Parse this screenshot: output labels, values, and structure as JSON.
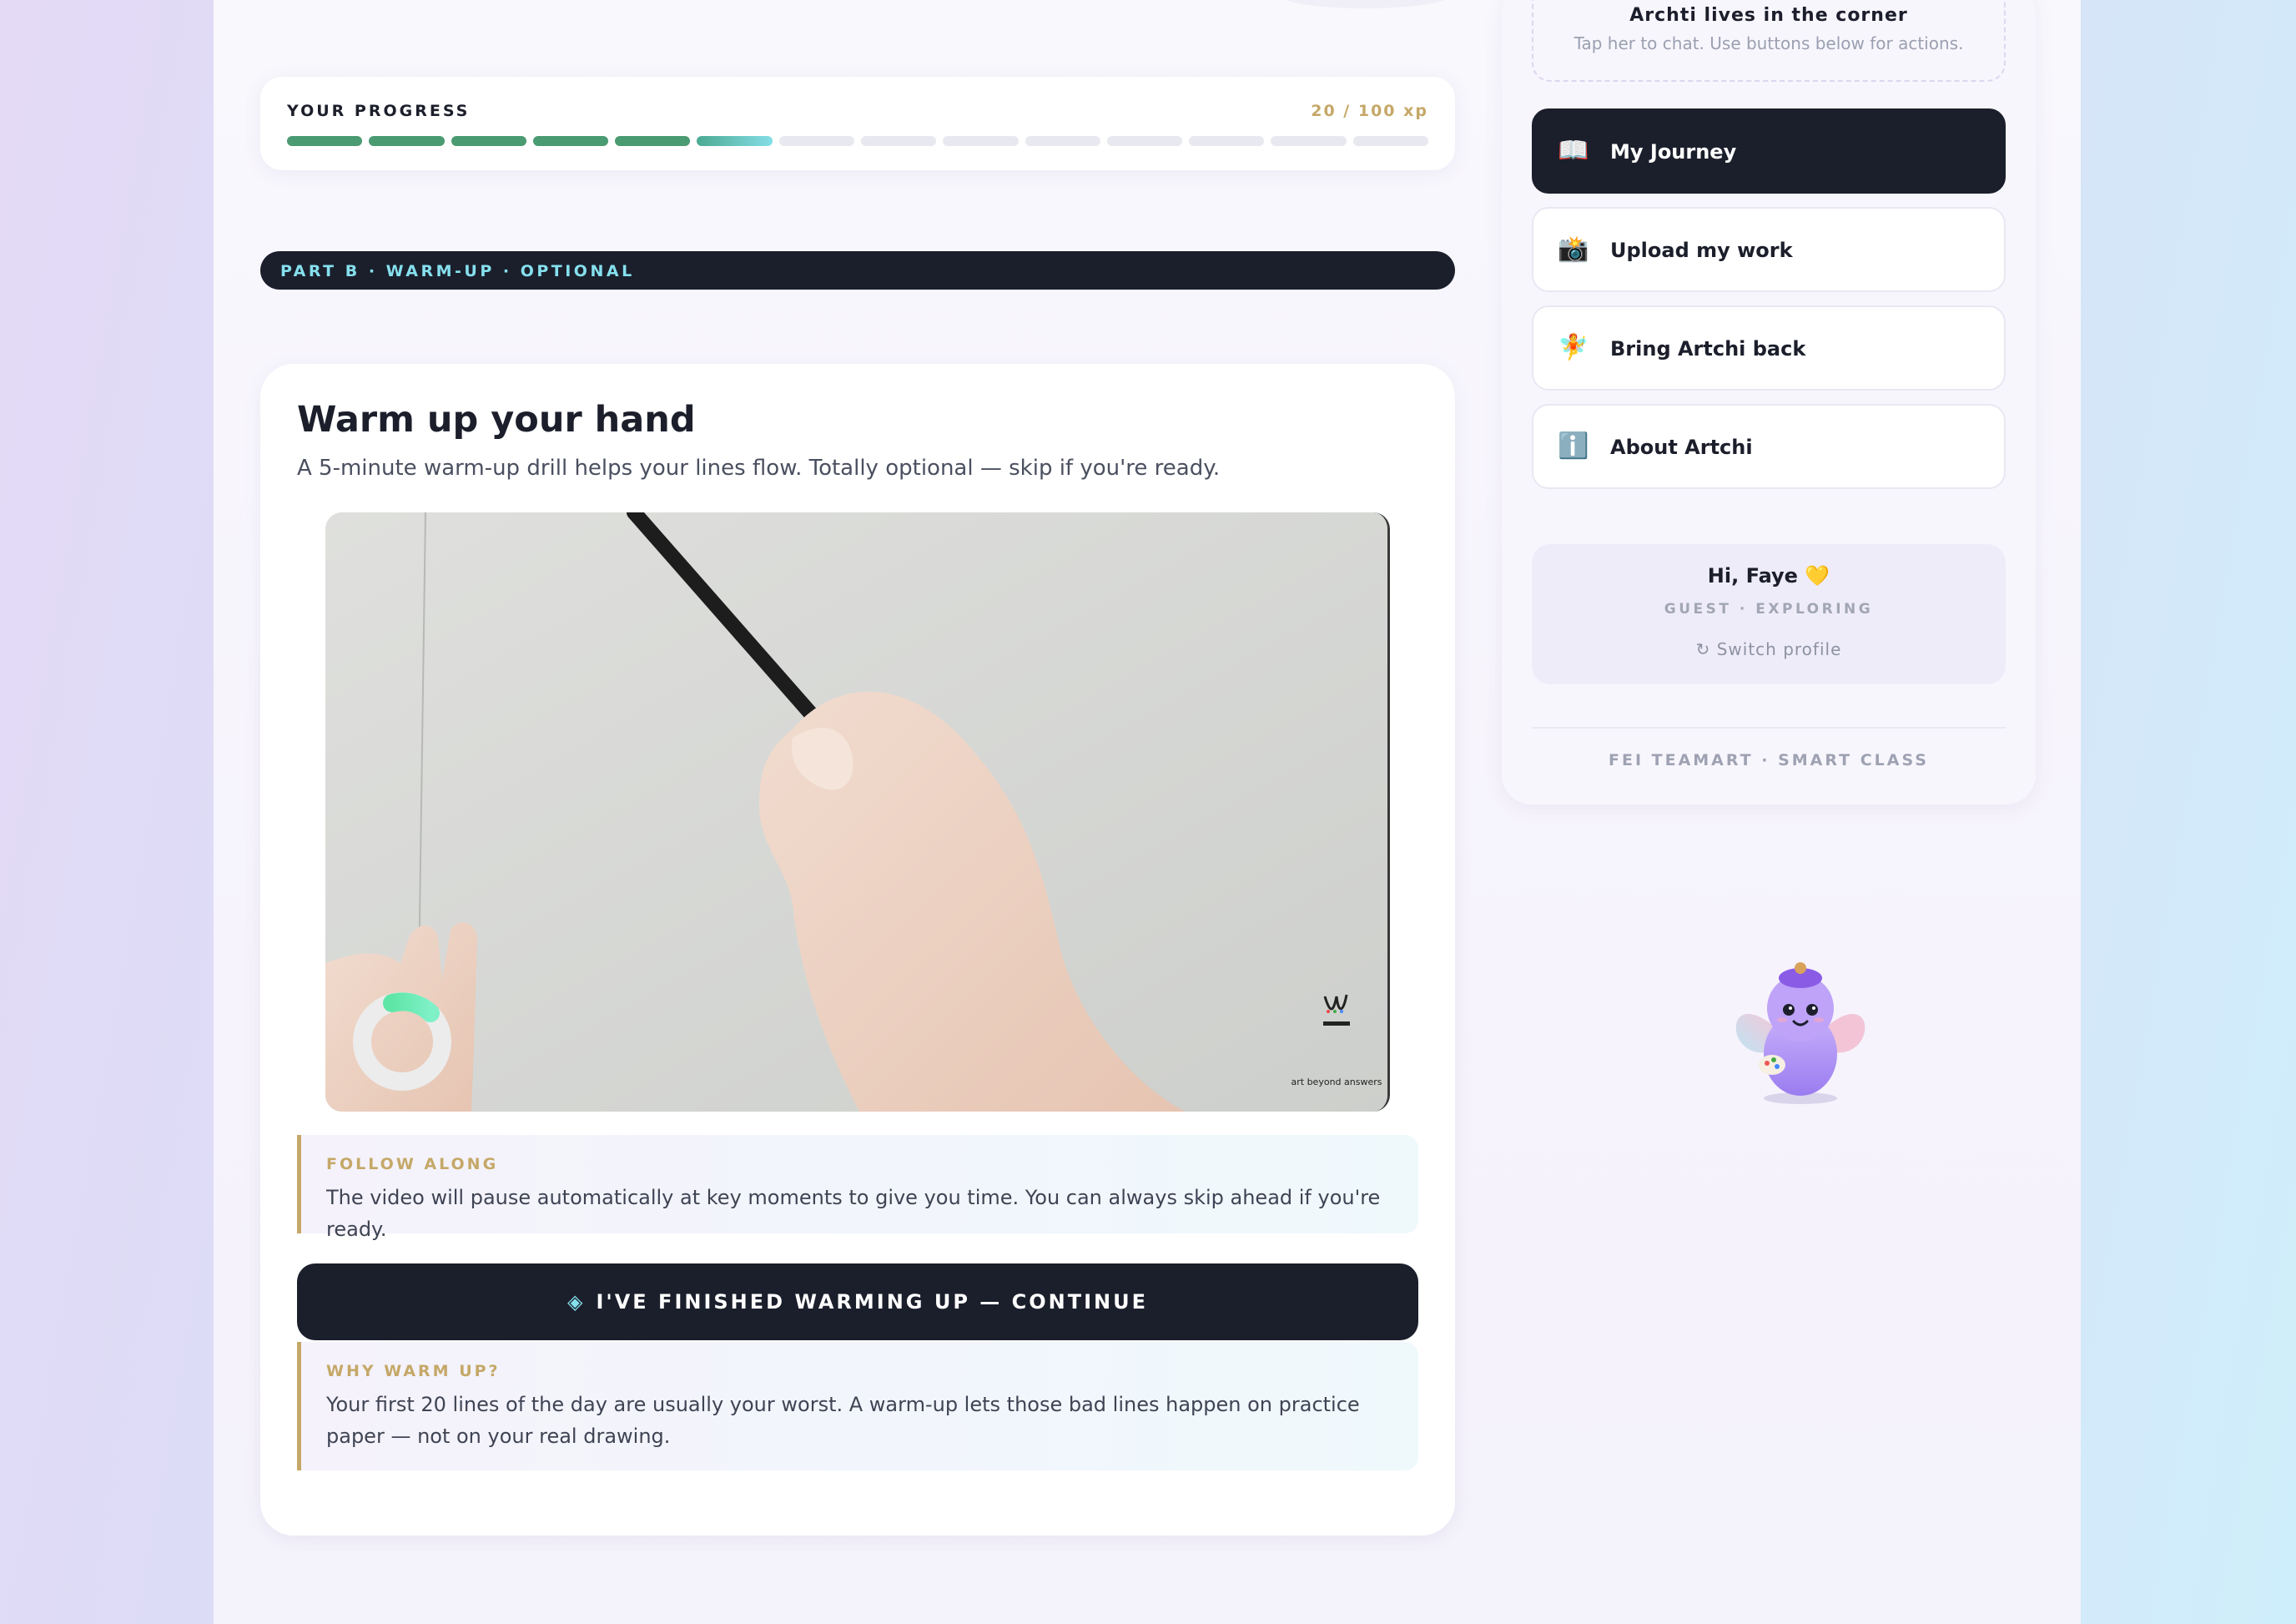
{
  "progress": {
    "label": "YOUR PROGRESS",
    "xp_text": "20 / 100 xp",
    "completed_segments": 5,
    "current_segment": 6,
    "total_segments": 14
  },
  "part_label": "PART B · WARM-UP · OPTIONAL",
  "main": {
    "title": "Warm up your hand",
    "subtitle": "A 5-minute warm-up drill helps your lines flow. Totally optional — skip if you're ready.",
    "video": {
      "watermark_text": "art beyond answers",
      "playback_progress": 0.15
    },
    "follow_along": {
      "title": "FOLLOW ALONG",
      "text": "The video will pause automatically at key moments to give you time. You can always skip ahead if you're ready."
    },
    "continue_button": {
      "icon": "diamond-icon",
      "label": "I'VE FINISHED WARMING UP — CONTINUE"
    },
    "why": {
      "title": "WHY WARM UP?",
      "text": "Your first 20 lines of the day are usually your worst. A warm-up lets those bad lines happen on practice paper — not on your real drawing."
    }
  },
  "sidebar": {
    "tip_title": "Archti lives in the corner",
    "tip_sub": "Tap her to chat. Use buttons below for actions.",
    "nav": [
      {
        "icon": "📖",
        "icon_name": "book-icon",
        "label": "My Journey",
        "active": true
      },
      {
        "icon": "📸",
        "icon_name": "camera-icon",
        "label": "Upload my work",
        "active": false
      },
      {
        "icon": "🧚",
        "icon_name": "fairy-icon",
        "label": "Bring Artchi back",
        "active": false
      },
      {
        "icon": "ℹ️",
        "icon_name": "info-icon",
        "label": "About Artchi",
        "active": false
      }
    ],
    "profile": {
      "greeting": "Hi, Faye 💛",
      "role": "GUEST · EXPLORING",
      "switch_label": "↻ Switch profile"
    },
    "footer": "FEI TEAMART · SMART CLASS"
  },
  "colors": {
    "dark": "#1b1f2c",
    "accent_cyan": "#86e0ee",
    "accent_gold": "#c5a868",
    "progress_green": "#4a9a72"
  }
}
